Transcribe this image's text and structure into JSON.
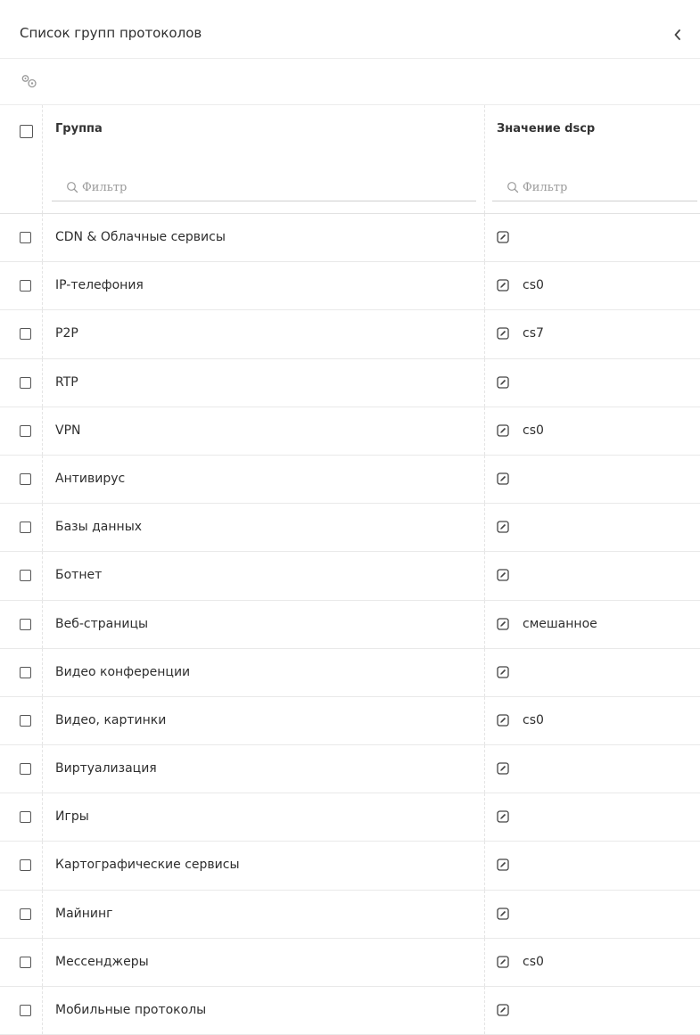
{
  "panel": {
    "title": "Список групп протоколов"
  },
  "icons": {
    "collapse": "chevron-left-icon",
    "settings": "gears-icon",
    "search": "search-icon",
    "edit": "edit-square-icon"
  },
  "table": {
    "columns": [
      {
        "key": "group",
        "label": "Группа",
        "filter_placeholder": "Фильтр"
      },
      {
        "key": "dscp",
        "label": "Значение dscp",
        "filter_placeholder": "Фильтр"
      }
    ],
    "rows": [
      {
        "group": "CDN & Облачные сервисы",
        "dscp": ""
      },
      {
        "group": "IP-телефония",
        "dscp": "cs0"
      },
      {
        "group": "P2P",
        "dscp": "cs7"
      },
      {
        "group": "RTP",
        "dscp": ""
      },
      {
        "group": "VPN",
        "dscp": "cs0"
      },
      {
        "group": "Антивирус",
        "dscp": ""
      },
      {
        "group": "Базы данных",
        "dscp": ""
      },
      {
        "group": "Ботнет",
        "dscp": ""
      },
      {
        "group": "Веб-страницы",
        "dscp": "смешанное"
      },
      {
        "group": "Видео конференции",
        "dscp": ""
      },
      {
        "group": "Видео, картинки",
        "dscp": "cs0"
      },
      {
        "group": "Виртуализация",
        "dscp": ""
      },
      {
        "group": "Игры",
        "dscp": ""
      },
      {
        "group": "Картографические сервисы",
        "dscp": ""
      },
      {
        "group": "Майнинг",
        "dscp": ""
      },
      {
        "group": "Мессенджеры",
        "dscp": "cs0"
      },
      {
        "group": "Мобильные протоколы",
        "dscp": ""
      }
    ]
  }
}
